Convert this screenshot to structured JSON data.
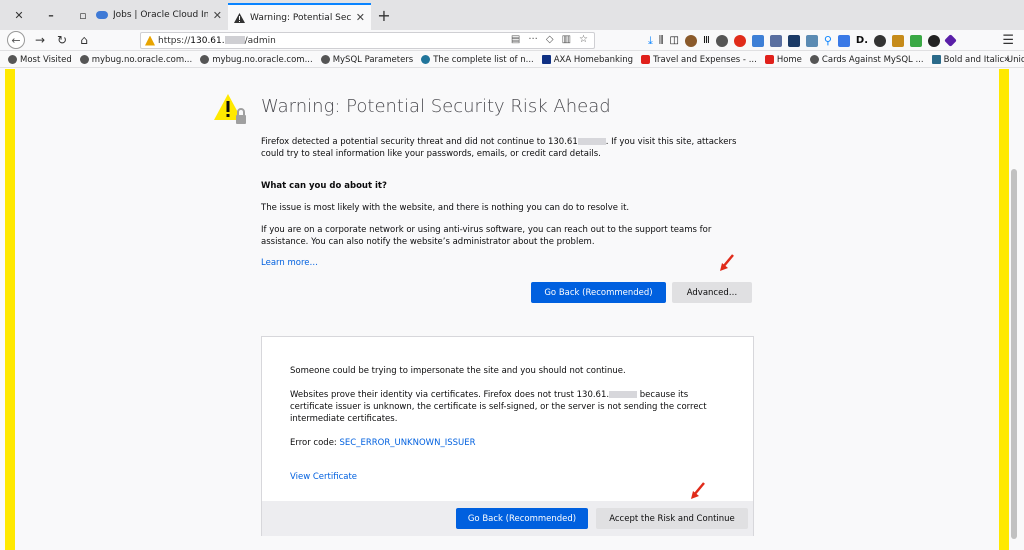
{
  "tabs": [
    {
      "title": "Jobs | Oracle Cloud Infrastru",
      "icon": "cloud-icon",
      "active": false
    },
    {
      "title": "Warning: Potential Security Ri",
      "icon": "warning-icon",
      "active": true
    }
  ],
  "url": {
    "prefix": "https://",
    "host": "130.61.",
    "path": "/admin"
  },
  "bookmarks": [
    {
      "label": "Most Visited",
      "icon": "gear-icon",
      "color": "#555555"
    },
    {
      "label": "mybug.no.oracle.com...",
      "icon": "globe-icon",
      "color": "#555555"
    },
    {
      "label": "mybug.no.oracle.com...",
      "icon": "globe-icon",
      "color": "#555555"
    },
    {
      "label": "MySQL Parameters",
      "icon": "globe-icon",
      "color": "#555555"
    },
    {
      "label": "The complete list of n...",
      "icon": "wordpress-icon",
      "color": "#21759b"
    },
    {
      "label": "AXA Homebanking",
      "icon": "axa-icon",
      "color": "#103184"
    },
    {
      "label": "Travel and Expenses - ...",
      "icon": "oracle-icon",
      "color": "#e0201b"
    },
    {
      "label": "Home",
      "icon": "oracle-icon",
      "color": "#e0201b"
    },
    {
      "label": "Cards Against MySQL ...",
      "icon": "globe-icon",
      "color": "#555555"
    },
    {
      "label": "Bold and Italic Unicod...",
      "icon": "app-icon",
      "color": "#2a6a8a"
    }
  ],
  "warning": {
    "title": "Warning: Potential Security Risk Ahead",
    "intro_a": "Firefox detected a potential security threat and did not continue to 130.61",
    "intro_b": ". If you visit this site, attackers could try to steal information like your passwords, emails, or credit card details.",
    "what_heading": "What can you do about it?",
    "issue_text": "The issue is most likely with the website, and there is nothing you can do to resolve it.",
    "network_text": "If you are on a corporate network or using anti-virus software, you can reach out to the support teams for assistance. You can also notify the website’s administrator about the problem.",
    "learn_more": "Learn more…",
    "go_back": "Go Back (Recommended)",
    "advanced": "Advanced…"
  },
  "advanced_panel": {
    "impersonate": "Someone could be trying to impersonate the site and you should not continue.",
    "cert_a": "Websites prove their identity via certificates. Firefox does not trust 130.61.",
    "cert_b": " because its certificate issuer is unknown, the certificate is self-signed, or the server is not sending the correct intermediate certificates.",
    "error_label": "Error code: ",
    "error_code": "SEC_ERROR_UNKNOWN_ISSUER",
    "view_cert": "View Certificate",
    "go_back": "Go Back (Recommended)",
    "accept": "Accept the Risk and Continue"
  },
  "colors": {
    "accent": "#0060df",
    "stripe": "#ffe900",
    "arrow": "#e02b1a"
  }
}
